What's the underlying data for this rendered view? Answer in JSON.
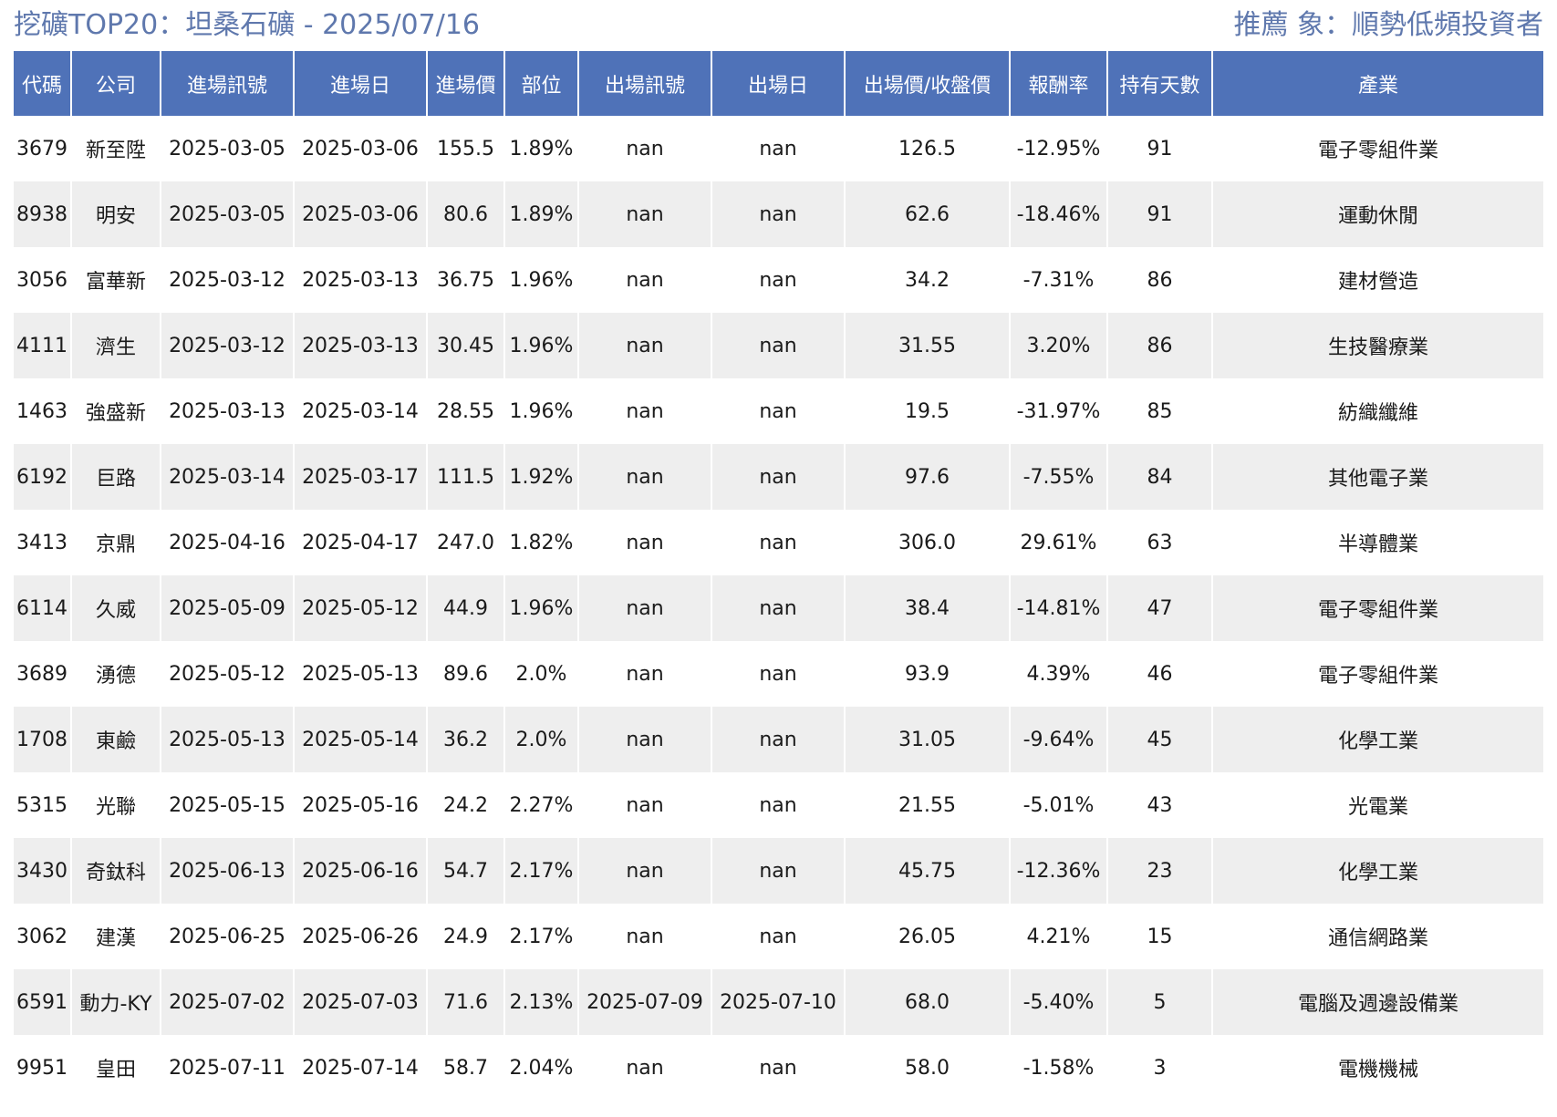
{
  "header": {
    "title": "挖礦TOP20：坦桑石礦 - 2025/07/16",
    "subtitle": "推薦 象：順勢低頻投資者"
  },
  "table": {
    "columns": [
      "代碼",
      "公司",
      "進場訊號",
      "進場日",
      "進場價",
      "部位",
      "出場訊號",
      "出場日",
      "出場價/收盤價",
      "報酬率",
      "持有天數",
      "產業"
    ],
    "rows": [
      [
        "3679",
        "新至陞",
        "2025-03-05",
        "2025-03-06",
        "155.5",
        "1.89%",
        "nan",
        "nan",
        "126.5",
        "-12.95%",
        "91",
        "電子零組件業"
      ],
      [
        "8938",
        "明安",
        "2025-03-05",
        "2025-03-06",
        "80.6",
        "1.89%",
        "nan",
        "nan",
        "62.6",
        "-18.46%",
        "91",
        "運動休閒"
      ],
      [
        "3056",
        "富華新",
        "2025-03-12",
        "2025-03-13",
        "36.75",
        "1.96%",
        "nan",
        "nan",
        "34.2",
        "-7.31%",
        "86",
        "建材營造"
      ],
      [
        "4111",
        "濟生",
        "2025-03-12",
        "2025-03-13",
        "30.45",
        "1.96%",
        "nan",
        "nan",
        "31.55",
        "3.20%",
        "86",
        "生技醫療業"
      ],
      [
        "1463",
        "強盛新",
        "2025-03-13",
        "2025-03-14",
        "28.55",
        "1.96%",
        "nan",
        "nan",
        "19.5",
        "-31.97%",
        "85",
        "紡織纖維"
      ],
      [
        "6192",
        "巨路",
        "2025-03-14",
        "2025-03-17",
        "111.5",
        "1.92%",
        "nan",
        "nan",
        "97.6",
        "-7.55%",
        "84",
        "其他電子業"
      ],
      [
        "3413",
        "京鼎",
        "2025-04-16",
        "2025-04-17",
        "247.0",
        "1.82%",
        "nan",
        "nan",
        "306.0",
        "29.61%",
        "63",
        "半導體業"
      ],
      [
        "6114",
        "久威",
        "2025-05-09",
        "2025-05-12",
        "44.9",
        "1.96%",
        "nan",
        "nan",
        "38.4",
        "-14.81%",
        "47",
        "電子零組件業"
      ],
      [
        "3689",
        "湧德",
        "2025-05-12",
        "2025-05-13",
        "89.6",
        "2.0%",
        "nan",
        "nan",
        "93.9",
        "4.39%",
        "46",
        "電子零組件業"
      ],
      [
        "1708",
        "東鹼",
        "2025-05-13",
        "2025-05-14",
        "36.2",
        "2.0%",
        "nan",
        "nan",
        "31.05",
        "-9.64%",
        "45",
        "化學工業"
      ],
      [
        "5315",
        "光聯",
        "2025-05-15",
        "2025-05-16",
        "24.2",
        "2.27%",
        "nan",
        "nan",
        "21.55",
        "-5.01%",
        "43",
        "光電業"
      ],
      [
        "3430",
        "奇鈦科",
        "2025-06-13",
        "2025-06-16",
        "54.7",
        "2.17%",
        "nan",
        "nan",
        "45.75",
        "-12.36%",
        "23",
        "化學工業"
      ],
      [
        "3062",
        "建漢",
        "2025-06-25",
        "2025-06-26",
        "24.9",
        "2.17%",
        "nan",
        "nan",
        "26.05",
        "4.21%",
        "15",
        "通信網路業"
      ],
      [
        "6591",
        "動力-KY",
        "2025-07-02",
        "2025-07-03",
        "71.6",
        "2.13%",
        "2025-07-09",
        "2025-07-10",
        "68.0",
        "-5.40%",
        "5",
        "電腦及週邊設備業"
      ],
      [
        "9951",
        "皇田",
        "2025-07-11",
        "2025-07-14",
        "58.7",
        "2.04%",
        "nan",
        "nan",
        "58.0",
        "-1.58%",
        "3",
        "電機機械"
      ]
    ]
  },
  "colors": {
    "header_bg": "#4f72b8",
    "title_color": "#5f78ad",
    "stripe": "#eeeeee"
  }
}
